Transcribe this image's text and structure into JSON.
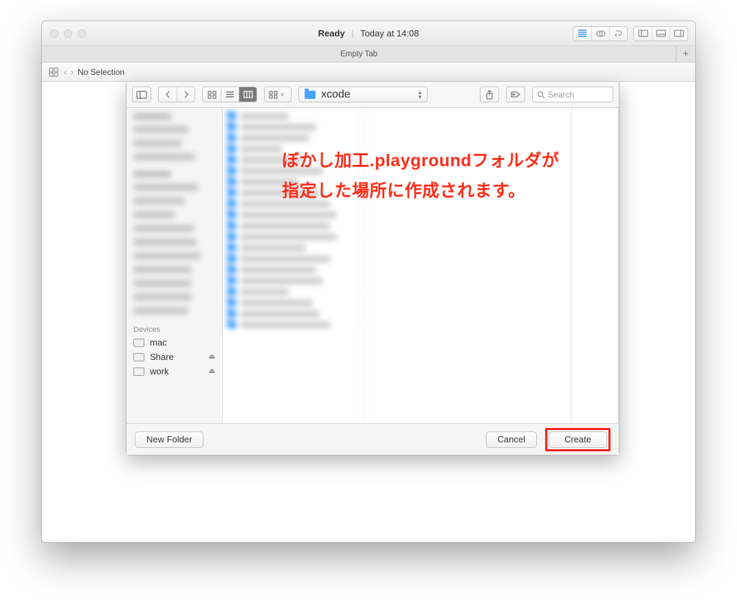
{
  "titlebar": {
    "status": "Ready",
    "time": "Today at 14:08"
  },
  "tabbar": {
    "tab_label": "Empty Tab",
    "add_glyph": "+"
  },
  "navrow": {
    "breadcrumb": "No Selection"
  },
  "sheet": {
    "toolbar": {
      "grouping_label": "",
      "path_label": "xcode",
      "search_placeholder": "Search"
    },
    "sidebar": {
      "devices_label": "Devices",
      "devices": [
        {
          "label": "mac",
          "ejectable": false
        },
        {
          "label": "Share",
          "ejectable": true
        },
        {
          "label": "work",
          "ejectable": true
        }
      ]
    },
    "footer": {
      "new_folder": "New Folder",
      "cancel": "Cancel",
      "create": "Create"
    }
  },
  "annotation": {
    "line1": "ぼかし加工.playgroundフォルダが",
    "line2": "指定した場所に作成されます。"
  }
}
